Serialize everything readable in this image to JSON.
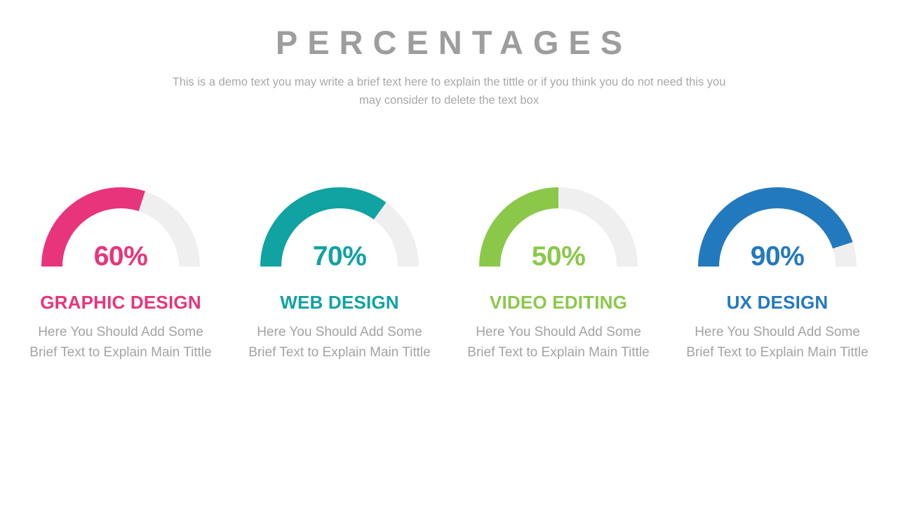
{
  "header": {
    "title": "PERCENTAGES",
    "subtitle": "This is a demo text you may write a brief text here to explain the tittle or if you think you do not need this you may consider to delete the text box"
  },
  "colors": {
    "title_gray": "#9d9d9d",
    "body_gray": "#a3a3a3",
    "track_gray": "#efefef",
    "pink": "#e8347a",
    "teal": "#11a2a2",
    "green": "#8bc84a",
    "blue": "#2379bd",
    "background": "#ffffff"
  },
  "chart_data": {
    "type": "bar",
    "title": "PERCENTAGES",
    "subtitle": "This is a demo text you may write a brief text here to explain the tittle or if you think you do not need this you may consider to delete the text box",
    "xlabel": "",
    "ylabel": "",
    "ylim": [
      0,
      100
    ],
    "categories": [
      "GRAPHIC DESIGN",
      "WEB DESIGN",
      "VIDEO EDITING",
      "UX DESIGN"
    ],
    "values": [
      60,
      70,
      50,
      90
    ],
    "value_labels": [
      "60%",
      "70%",
      "50%",
      "90%"
    ],
    "colors": [
      "#e8347a",
      "#11a2a2",
      "#8bc84a",
      "#2379bd"
    ],
    "gauge_sweep_degrees": 180,
    "grid": false,
    "legend": "none"
  },
  "gauges": [
    {
      "percent_label": "60%",
      "value": 60,
      "title": "GRAPHIC DESIGN",
      "description": "Here You Should Add Some Brief Text to Explain Main Tittle",
      "color": "#e8347a"
    },
    {
      "percent_label": "70%",
      "value": 70,
      "title": "WEB DESIGN",
      "description": "Here You Should Add Some Brief Text to Explain Main Tittle",
      "color": "#11a2a2"
    },
    {
      "percent_label": "50%",
      "value": 50,
      "title": "VIDEO EDITING",
      "description": "Here You Should Add Some Brief Text to Explain Main Tittle",
      "color": "#8bc84a"
    },
    {
      "percent_label": "90%",
      "value": 90,
      "title": "UX DESIGN",
      "description": "Here You Should Add Some Brief Text to Explain Main Tittle",
      "color": "#2379bd"
    }
  ]
}
